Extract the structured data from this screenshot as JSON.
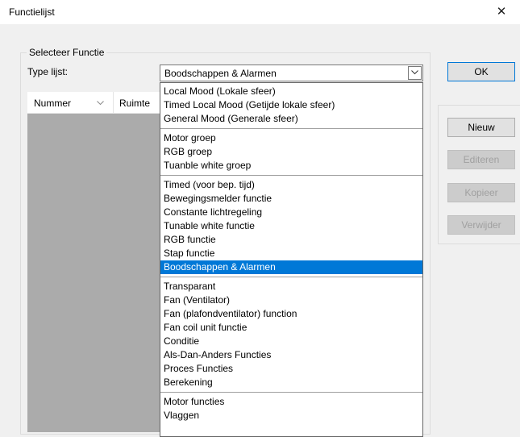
{
  "window": {
    "title": "Functielijst",
    "close_glyph": "✕"
  },
  "group": {
    "legend": "Selecteer Functie",
    "type_label": "Type lijst:"
  },
  "combo": {
    "selected": "Boodschappen & Alarmen"
  },
  "list": {
    "columns": [
      "Nummer",
      "Ruimte"
    ]
  },
  "dropdown": {
    "groups": [
      [
        "Local Mood (Lokale sfeer)",
        "Timed Local Mood (Getijde lokale sfeer)",
        "General Mood (Generale sfeer)"
      ],
      [
        "Motor groep",
        "RGB groep",
        "Tuanble white groep"
      ],
      [
        "Timed (voor bep. tijd)",
        "Bewegingsmelder functie",
        "Constante lichtregeling",
        "Tunable white functie",
        "RGB functie",
        "Stap functie",
        "Boodschappen & Alarmen"
      ],
      [
        "Transparant",
        "Fan (Ventilator)",
        "Fan (plafondventilator) function",
        "Fan coil unit functie",
        "Conditie",
        "Als-Dan-Anders Functies",
        "Proces Functies",
        "Berekening"
      ],
      [
        "Motor functies",
        "Vlaggen"
      ]
    ],
    "selected_item": "Boodschappen & Alarmen",
    "highlight_color": "#0078d7"
  },
  "buttons": {
    "ok": "OK",
    "new": "Nieuw",
    "edit": "Editeren",
    "copy": "Kopieer",
    "delete": "Verwijder"
  }
}
